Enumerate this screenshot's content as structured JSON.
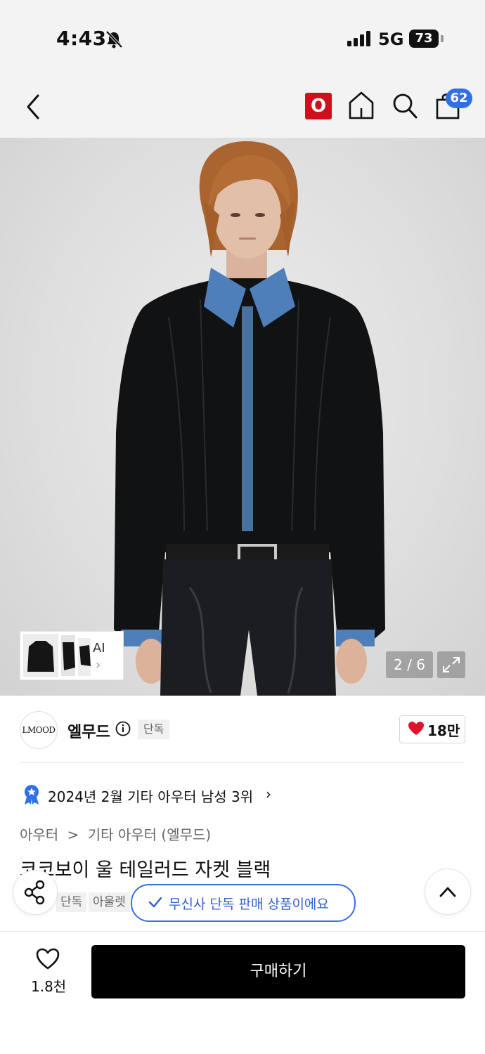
{
  "status_bar": {
    "time": "4:43",
    "network": "5G",
    "battery": "73"
  },
  "app_bar": {
    "icons": [
      "back-arrow-icon",
      "o-badge-icon",
      "home-icon",
      "search-icon",
      "shopping-bag-icon"
    ],
    "o_badge_label": "O",
    "cart_count": "62",
    "accent_color": "#d00f1c",
    "badge_color": "#2f6fe8"
  },
  "gallery": {
    "ai_label": "AI",
    "current": "2",
    "total": "6",
    "pager_text": "2 / 6"
  },
  "brand": {
    "logo_text": "LMOOD",
    "name": "엘무드",
    "exclusive_tag": "단독",
    "like_count": "18만",
    "heart_color": "#e0122b"
  },
  "ranking": {
    "text": "2024년 2월 기타 아우터 남성 3위",
    "chevron": "›"
  },
  "breadcrumb": {
    "items": [
      "아우터",
      "기타 아우터 (엘무드)"
    ],
    "separator": ">"
  },
  "product": {
    "title": "코코보이 울 테일러드 자켓 블랙",
    "tags": [
      "단독",
      "아울렛"
    ]
  },
  "toast": {
    "text": "무신사 단독 판매 상품이에요",
    "color": "#2f5fd0"
  },
  "bottom_bar": {
    "wish_count": "1.8천",
    "buy_label": "구매하기"
  }
}
